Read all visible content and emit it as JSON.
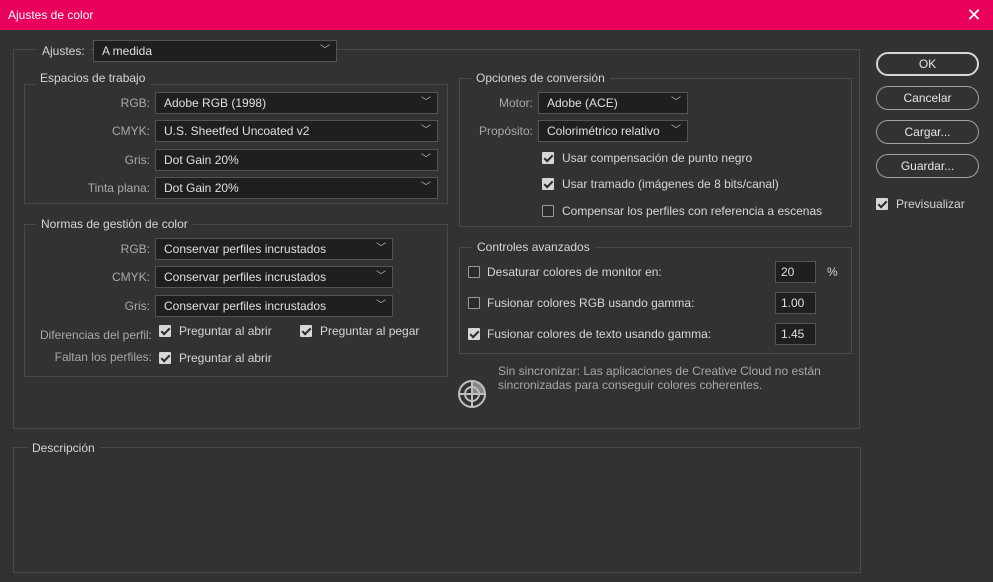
{
  "window": {
    "title": "Ajustes de color"
  },
  "settings": {
    "label": "Ajustes:",
    "value": "A medida"
  },
  "working_spaces": {
    "legend": "Espacios de trabajo",
    "rows": [
      {
        "label": "RGB:",
        "value": "Adobe RGB (1998)"
      },
      {
        "label": "CMYK:",
        "value": "U.S. Sheetfed Uncoated v2"
      },
      {
        "label": "Gris:",
        "value": "Dot Gain 20%"
      },
      {
        "label": "Tinta plana:",
        "value": "Dot Gain 20%"
      }
    ]
  },
  "policies": {
    "legend": "Normas de gestión de color",
    "rows": [
      {
        "label": "RGB:",
        "value": "Conservar perfiles incrustados"
      },
      {
        "label": "CMYK:",
        "value": "Conservar perfiles incrustados"
      },
      {
        "label": "Gris:",
        "value": "Conservar perfiles incrustados"
      }
    ],
    "mismatch": {
      "label": "Diferencias del perfil:",
      "ask_open": {
        "label": "Preguntar al abrir",
        "checked": true
      },
      "ask_paste": {
        "label": "Preguntar al pegar",
        "checked": true
      }
    },
    "missing": {
      "label": "Faltan los perfiles:",
      "ask_open": {
        "label": "Preguntar al abrir",
        "checked": true
      }
    }
  },
  "conversion": {
    "legend": "Opciones de conversión",
    "engine": {
      "label": "Motor:",
      "value": "Adobe (ACE)"
    },
    "intent": {
      "label": "Propósito:",
      "value": "Colorimétrico relativo"
    },
    "options": [
      {
        "label": "Usar compensación de punto negro",
        "checked": true
      },
      {
        "label": "Usar tramado (imágenes de 8 bits/canal)",
        "checked": true
      },
      {
        "label": "Compensar los perfiles con referencia a escenas",
        "checked": false
      }
    ]
  },
  "advanced": {
    "legend": "Controles avanzados",
    "rows": [
      {
        "label": "Desaturar colores de monitor en:",
        "checked": false,
        "value": "20",
        "unit": "%"
      },
      {
        "label": "Fusionar colores RGB usando gamma:",
        "checked": false,
        "value": "1.00"
      },
      {
        "label": "Fusionar colores de texto usando gamma:",
        "checked": true,
        "value": "1.45"
      }
    ]
  },
  "sync": {
    "line1": "Sin sincronizar: Las aplicaciones de Creative Cloud no están",
    "line2": "sincronizadas para conseguir colores coherentes.",
    "icon": "color-sync-icon"
  },
  "description": {
    "legend": "Descripción"
  },
  "buttons": {
    "ok": "OK",
    "cancel": "Cancelar",
    "load": "Cargar...",
    "save": "Guardar..."
  },
  "preview": {
    "label": "Previsualizar",
    "checked": true
  },
  "colors": {
    "titlebar": "#e9005b",
    "background": "#323232",
    "field": "#1f1f1f"
  }
}
